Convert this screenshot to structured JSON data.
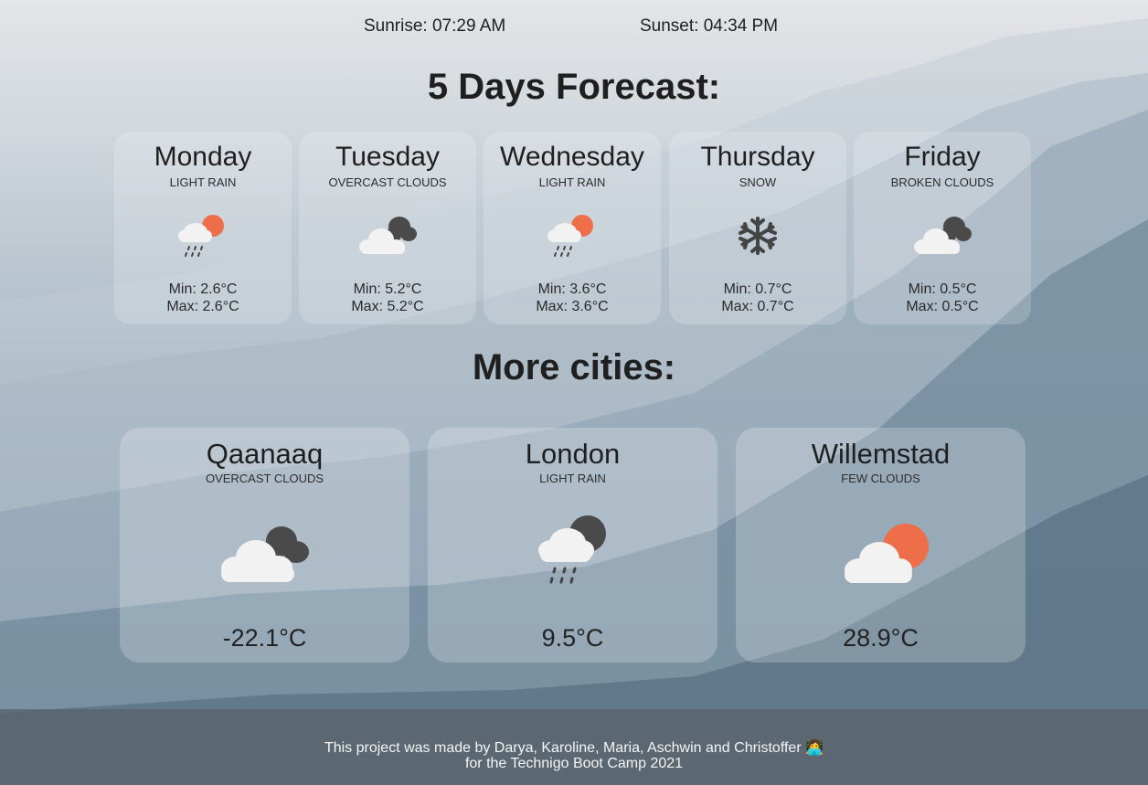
{
  "sun": {
    "sunrise": "Sunrise: 07:29 AM",
    "sunset": "Sunset: 04:34 PM"
  },
  "forecast": {
    "heading": "5 Days Forecast:",
    "days": [
      {
        "name": "Monday",
        "desc": "LIGHT RAIN",
        "icon": "light-rain-icon",
        "min": "Min: 2.6°C",
        "max": "Max: 2.6°C"
      },
      {
        "name": "Tuesday",
        "desc": "OVERCAST CLOUDS",
        "icon": "overcast-clouds-icon",
        "min": "Min: 5.2°C",
        "max": "Max: 5.2°C"
      },
      {
        "name": "Wednesday",
        "desc": "LIGHT RAIN",
        "icon": "light-rain-icon",
        "min": "Min: 3.6°C",
        "max": "Max: 3.6°C"
      },
      {
        "name": "Thursday",
        "desc": "SNOW",
        "icon": "snowflake-icon",
        "min": "Min: 0.7°C",
        "max": "Max: 0.7°C"
      },
      {
        "name": "Friday",
        "desc": "BROKEN CLOUDS",
        "icon": "broken-clouds-icon",
        "min": "Min: 0.5°C",
        "max": "Max: 0.5°C"
      }
    ]
  },
  "cities": {
    "heading": "More cities:",
    "items": [
      {
        "name": "Qaanaaq",
        "desc": "OVERCAST CLOUDS",
        "icon": "overcast-clouds-icon",
        "temp": "-22.1°C"
      },
      {
        "name": "London",
        "desc": "LIGHT RAIN",
        "icon": "rain-cloud-icon",
        "temp": "9.5°C"
      },
      {
        "name": "Willemstad",
        "desc": "FEW CLOUDS",
        "icon": "few-clouds-icon",
        "temp": "28.9°C"
      }
    ]
  },
  "footer": {
    "line1": "This project was made by Darya, Karoline, Maria, Aschwin and Christoffer",
    "line2": "for the Technigo Boot Camp 2021",
    "emoji": "👩‍💻"
  },
  "colors": {
    "sun_orange": "#ee6e4a",
    "cloud_white": "#f2f2f2",
    "cloud_dark": "#4a4a4a",
    "text_dark": "#1f1f1f"
  }
}
